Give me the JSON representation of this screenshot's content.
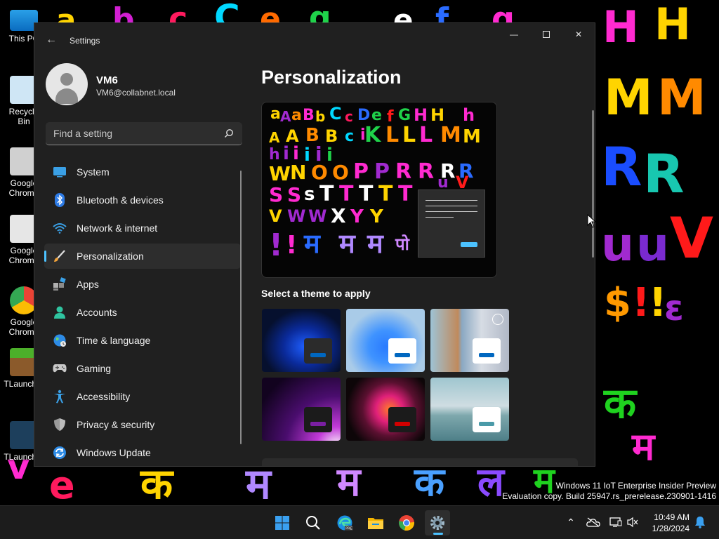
{
  "desktop": {
    "icons": [
      {
        "label": "This PC"
      },
      {
        "label": "Recycle Bin"
      },
      {
        "label": "Google Chrome"
      },
      {
        "label": "Google Chrome"
      },
      {
        "label": "Google Chrome"
      },
      {
        "label": "TLauncher"
      },
      {
        "label": "TLauncher"
      }
    ],
    "watermark_line1": "Windows 11 IoT Enterprise Insider Preview",
    "watermark_line2": "Evaluation copy. Build 25947.rs_prerelease.230901-1416"
  },
  "window": {
    "title": "Settings",
    "controls": {
      "minimize": "—",
      "close": "✕"
    },
    "user": {
      "name": "VM6",
      "email": "VM6@collabnet.local"
    },
    "search": {
      "placeholder": "Find a setting"
    },
    "nav": [
      {
        "label": "System",
        "icon": "system-icon",
        "selected": false
      },
      {
        "label": "Bluetooth & devices",
        "icon": "bluetooth-icon",
        "selected": false
      },
      {
        "label": "Network & internet",
        "icon": "wifi-icon",
        "selected": false
      },
      {
        "label": "Personalization",
        "icon": "brush-icon",
        "selected": true
      },
      {
        "label": "Apps",
        "icon": "apps-icon",
        "selected": false
      },
      {
        "label": "Accounts",
        "icon": "accounts-icon",
        "selected": false
      },
      {
        "label": "Time & language",
        "icon": "globe-icon",
        "selected": false
      },
      {
        "label": "Gaming",
        "icon": "gamepad-icon",
        "selected": false
      },
      {
        "label": "Accessibility",
        "icon": "accessibility-icon",
        "selected": false
      },
      {
        "label": "Privacy & security",
        "icon": "shield-icon",
        "selected": false
      },
      {
        "label": "Windows Update",
        "icon": "update-icon",
        "selected": false
      }
    ],
    "content": {
      "title": "Personalization",
      "themes_heading": "Select a theme to apply",
      "themes": [
        {
          "name": "windows-dark",
          "accent": "#0067c0"
        },
        {
          "name": "windows-light",
          "accent": "#0067c0"
        },
        {
          "name": "windows-spotlight",
          "accent": "#0067c0"
        },
        {
          "name": "glow",
          "accent": "#7a1fa2"
        },
        {
          "name": "captured-motion",
          "accent": "#d10000"
        },
        {
          "name": "flow",
          "accent": "#4a9aa8"
        }
      ]
    }
  },
  "taskbar": {
    "apps": [
      "start-icon",
      "search-icon",
      "edge-icon",
      "file-explorer-icon",
      "chrome-icon",
      "settings-icon"
    ],
    "active_app": "settings-icon",
    "time": "10:49 AM",
    "date": "1/28/2024"
  },
  "colors": {
    "accent": "#4cc2ff",
    "window_bg": "#202020",
    "selected_bg": "#2d2d2d"
  }
}
